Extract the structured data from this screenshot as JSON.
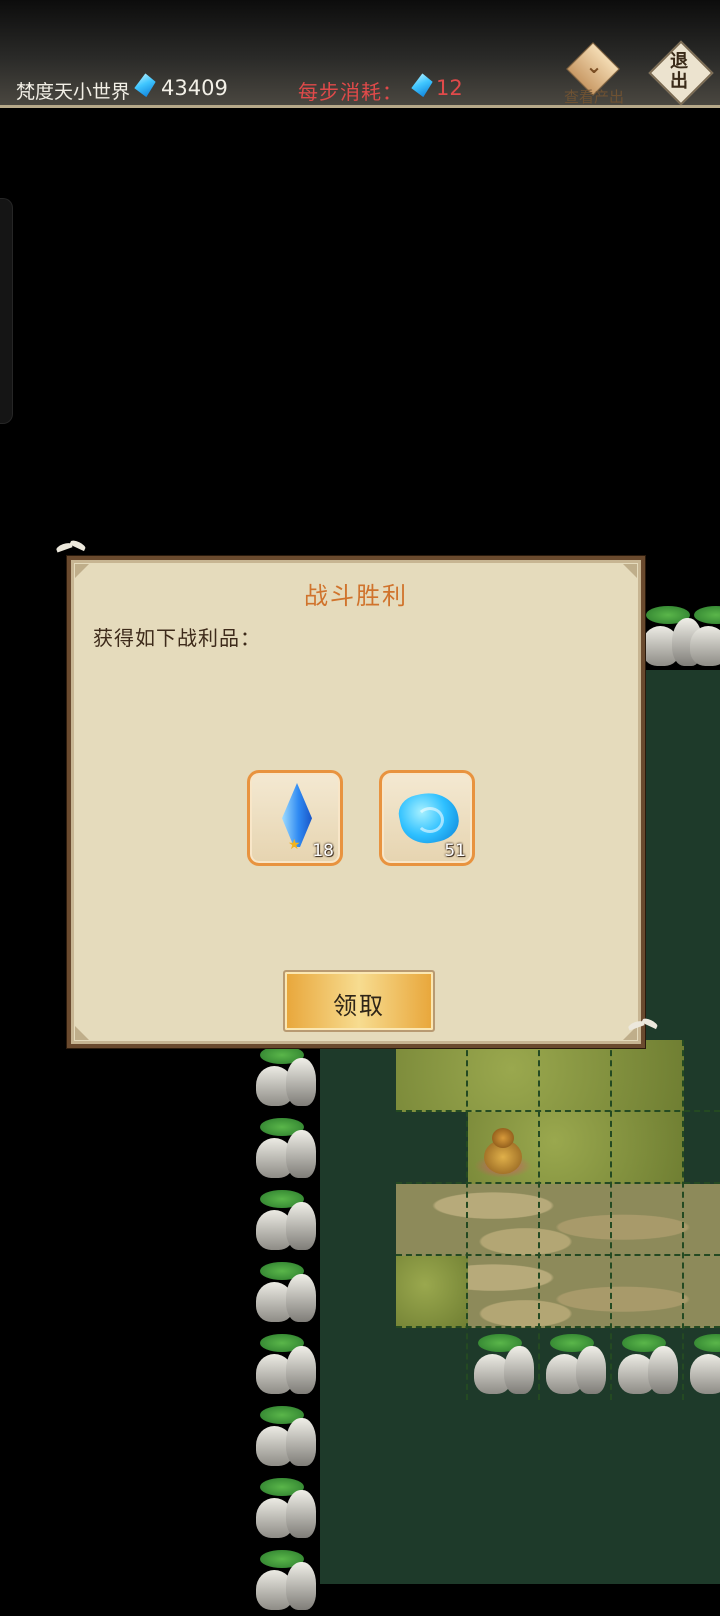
{
  "header": {
    "world_name": "梵度天小世界",
    "currency_icon": "blue-gem-icon",
    "balance": "43409",
    "step_cost_label": "每步消耗：",
    "step_cost_value": "12",
    "view_output_label": "查看产出",
    "exit_label": "退\n出"
  },
  "dialog": {
    "title": "战斗胜利",
    "subtitle": "获得如下战利品：",
    "rewards": [
      {
        "icon": "blue-crystal-shard-icon",
        "count": "18"
      },
      {
        "icon": "blue-ore-stone-icon",
        "count": "51"
      }
    ],
    "claim_label": "领取"
  },
  "colors": {
    "title": "#d0732c",
    "step_cost": "#e04a4a",
    "dialog_bg": "#e5dbbc",
    "dialog_border": "#6a4a2e",
    "reward_border": "#e8933f",
    "claim_button": "#f7dc90"
  }
}
